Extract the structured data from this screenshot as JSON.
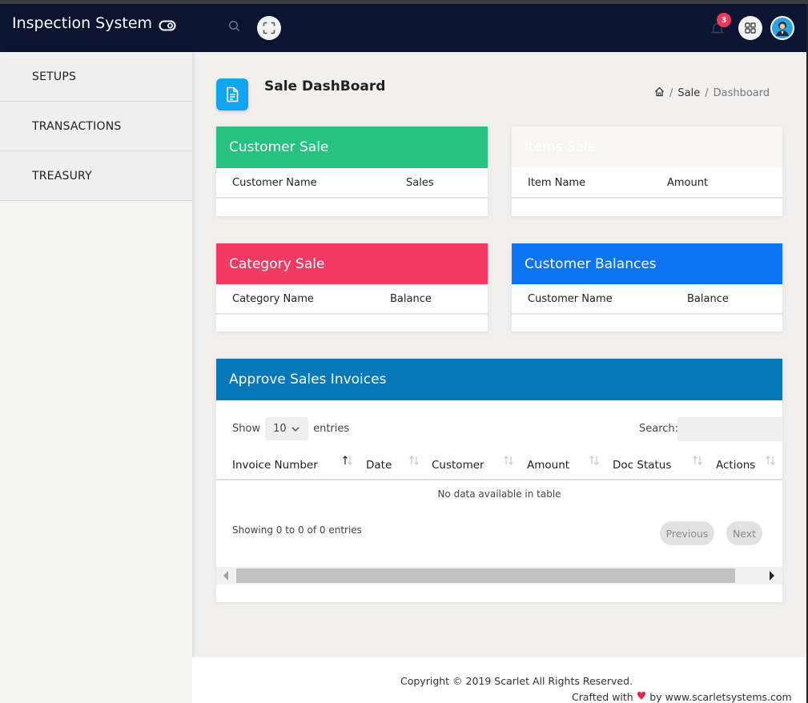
{
  "app": {
    "title": "Inspection System"
  },
  "topbar": {
    "notification_count": "3"
  },
  "sidebar": {
    "items": [
      {
        "label": "SETUPS"
      },
      {
        "label": "TRANSACTIONS"
      },
      {
        "label": "TREASURY"
      }
    ]
  },
  "page": {
    "title": "Sale DashBoard",
    "breadcrumb": {
      "sale": "Sale",
      "sep": "/",
      "current": "Dashboard"
    }
  },
  "cards": {
    "customer_sale": {
      "title": "Customer Sale",
      "col1": "Customer Name",
      "col2": "Sales",
      "color": "#27c281"
    },
    "items_sale": {
      "title": "Items Sale",
      "col1": "Item Name",
      "col2": "Amount",
      "color": "#f8f7f5"
    },
    "category_sale": {
      "title": "Category Sale",
      "col1": "Category Name",
      "col2": "Balance",
      "color": "#f33a63"
    },
    "customer_balances": {
      "title": "Customer Balances",
      "col1": "Customer Name",
      "col2": "Balance",
      "color": "#0a74f5"
    }
  },
  "invoices": {
    "title": "Approve Sales Invoices",
    "show_label": "Show",
    "page_length": "10",
    "entries_label": "entries",
    "search_label": "Search:",
    "search_value": "",
    "columns": [
      "Invoice Number",
      "Date",
      "Customer",
      "Amount",
      "Doc Status",
      "Actions"
    ],
    "empty_text": "No data available in table",
    "info_text": "Showing 0 to 0 of 0 entries",
    "prev_label": "Previous",
    "next_label": "Next",
    "header_color": "#0677b8"
  },
  "footer": {
    "copyright": "Copyright © 2019 Scarlet All Rights Reserved.",
    "crafted_prefix": "Crafted with",
    "crafted_suffix": "by www.scarletsystems.com"
  }
}
